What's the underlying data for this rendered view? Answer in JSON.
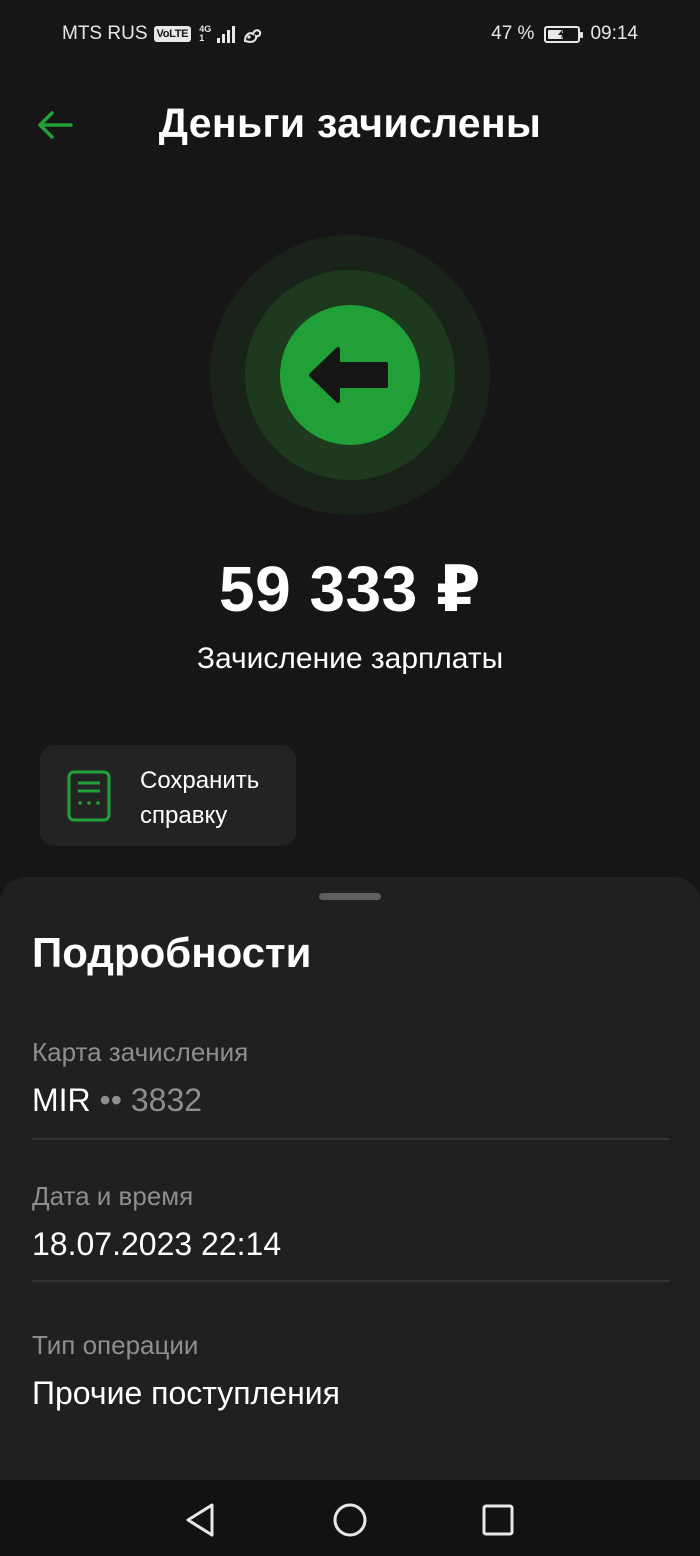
{
  "status_bar": {
    "carrier": "MTS RUS",
    "volte": "VoLTE",
    "network_type": "4G",
    "network_sub": "1",
    "battery": "47 %",
    "time": "09:14"
  },
  "header": {
    "title": "Деньги зачислены",
    "back_icon": "arrow-left-icon"
  },
  "hero": {
    "icon": "incoming-arrow-icon",
    "accent_color": "#21a038"
  },
  "transaction": {
    "amount": "59 333 ₽",
    "description": "Зачисление зарплаты"
  },
  "actions": {
    "save_certificate_label": "Сохранить\nсправку",
    "save_icon": "document-icon"
  },
  "details": {
    "title": "Подробности",
    "rows": [
      {
        "label": "Карта зачисления",
        "value_main": "MIR",
        "value_dots": "••",
        "value_tail": "3832"
      },
      {
        "label": "Дата и время",
        "value": "18.07.2023 22:14"
      },
      {
        "label": "Тип операции",
        "value": "Прочие поступления"
      }
    ]
  },
  "nav": {
    "back": "triangle-back-icon",
    "home": "circle-home-icon",
    "recents": "square-recents-icon"
  }
}
